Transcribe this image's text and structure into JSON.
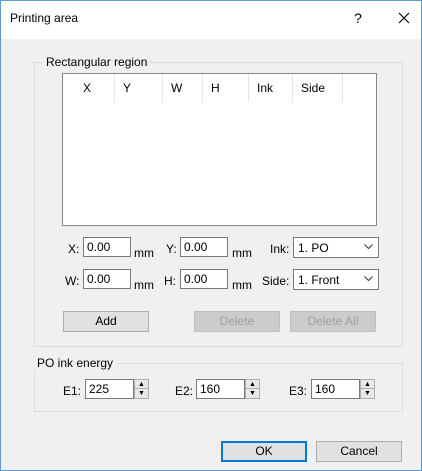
{
  "window": {
    "title": "Printing area",
    "help_glyph": "?",
    "close_glyph": "✕"
  },
  "rect_group": {
    "label": "Rectangular region",
    "columns": [
      "X",
      "Y",
      "W",
      "H",
      "Ink",
      "Side"
    ],
    "rows": [],
    "x_label": "X:",
    "x_value": "0.00",
    "y_label": "Y:",
    "y_value": "0.00",
    "w_label": "W:",
    "w_value": "0.00",
    "h_label": "H:",
    "h_value": "0.00",
    "unit": "mm",
    "ink_label": "Ink:",
    "ink_value": "1. PO",
    "side_label": "Side:",
    "side_value": "1. Front",
    "add_label": "Add",
    "delete_label": "Delete",
    "delete_all_label": "Delete All"
  },
  "energy_group": {
    "label": "PO ink energy",
    "e1_label": "E1:",
    "e1_value": "225",
    "e2_label": "E2:",
    "e2_value": "160",
    "e3_label": "E3:",
    "e3_value": "160"
  },
  "footer": {
    "ok_label": "OK",
    "cancel_label": "Cancel"
  },
  "icons": {
    "dropdown": "chevron-down-icon",
    "spin_up": "triangle-up-icon",
    "spin_down": "triangle-down-icon"
  }
}
